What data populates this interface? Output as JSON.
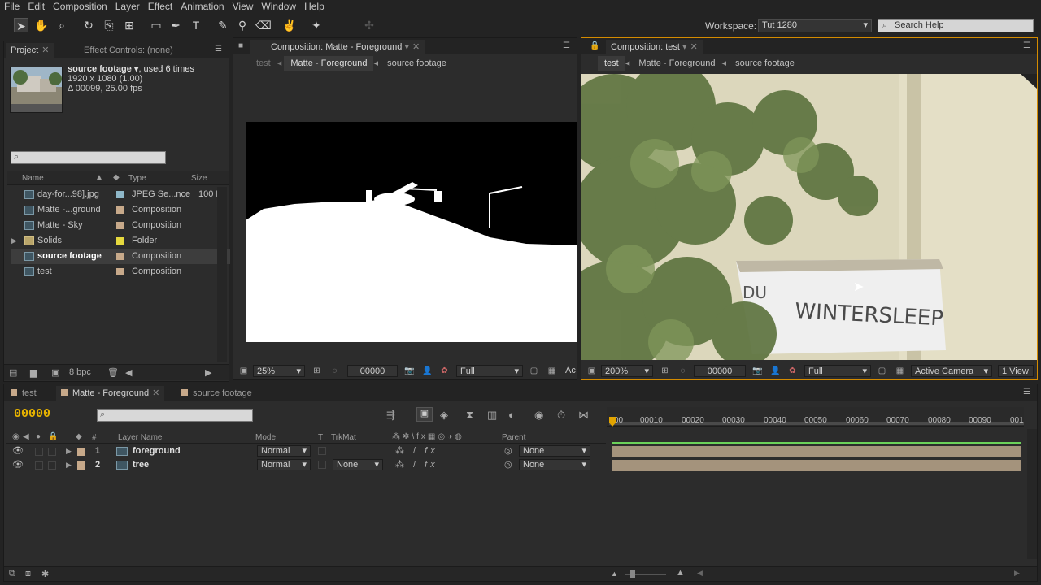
{
  "menubar": {
    "items": [
      "File",
      "Edit",
      "Composition",
      "Layer",
      "Effect",
      "Animation",
      "View",
      "Window",
      "Help"
    ]
  },
  "toolbar": {
    "workspace_label": "Workspace:",
    "workspace_value": "Tut 1280",
    "search_placeholder": "Search Help"
  },
  "project_panel": {
    "tab_project": "Project",
    "tab_effect_controls": "Effect Controls: (none)",
    "footage_name": "source footage ▾",
    "footage_used": ", used 6 times",
    "footage_res": "1920 x 1080 (1.00)",
    "footage_dur": "Δ 00099, 25.00 fps",
    "columns": {
      "name": "Name",
      "type": "Type",
      "size": "Size"
    },
    "items": [
      {
        "name": "day-for...98].jpg",
        "type": "JPEG Se...nce",
        "size": "100 M",
        "label_color": "#8fb8c9"
      },
      {
        "name": "Matte -...ground",
        "type": "Composition",
        "size": "",
        "label_color": "#c7a98a"
      },
      {
        "name": "Matte - Sky",
        "type": "Composition",
        "size": "",
        "label_color": "#c7a98a"
      },
      {
        "name": "Solids",
        "type": "Folder",
        "size": "",
        "label_color": "#e6d93e"
      },
      {
        "name": "source footage",
        "type": "Composition",
        "size": "",
        "label_color": "#c7a98a"
      },
      {
        "name": "test",
        "type": "Composition",
        "size": "",
        "label_color": "#c7a98a"
      }
    ],
    "bpc": "8 bpc"
  },
  "comp_left": {
    "tab": "Composition: Matte - Foreground",
    "breadcrumb": [
      "test",
      "Matte - Foreground",
      "source footage"
    ],
    "zoom": "25%",
    "timecode": "00000",
    "resolution": "Full",
    "extra": "Ac"
  },
  "comp_right": {
    "tab": "Composition: test",
    "breadcrumb": [
      "test",
      "Matte - Foreground",
      "source footage"
    ],
    "zoom": "200%",
    "timecode": "00000",
    "resolution": "Full",
    "camera": "Active Camera",
    "views": "1 View",
    "sign_text": "WINTERSLEEP",
    "sign_text2": "DU"
  },
  "timeline": {
    "tabs": [
      "test",
      "Matte - Foreground",
      "source footage"
    ],
    "timecode": "00000",
    "columns": {
      "layer_name": "Layer Name",
      "mode": "Mode",
      "t": "T",
      "trkmat": "TrkMat",
      "parent": "Parent",
      "num": "#"
    },
    "layers": [
      {
        "num": "1",
        "name": "foreground",
        "mode": "Normal",
        "trkmat": "",
        "parent": "None",
        "label_color": "#c7a98a"
      },
      {
        "num": "2",
        "name": "tree",
        "mode": "Normal",
        "trkmat": "None",
        "parent": "None",
        "label_color": "#c7a98a"
      }
    ],
    "ruler": [
      "00",
      "00010",
      "00020",
      "00030",
      "00040",
      "00050",
      "00060",
      "00070",
      "00080",
      "00090",
      "001"
    ]
  }
}
